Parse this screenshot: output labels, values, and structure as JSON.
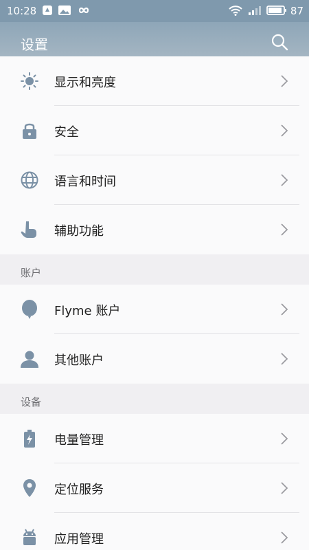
{
  "status_bar": {
    "time": "10:28",
    "battery_level": "87",
    "icons": [
      "notification-icon",
      "image-icon",
      "infinity-icon",
      "wifi-icon",
      "signal-icon",
      "battery-icon"
    ]
  },
  "header": {
    "title": "设置",
    "search_icon": "search-icon"
  },
  "sections": [
    {
      "header": "",
      "items": [
        {
          "label": "显示和亮度",
          "icon": "sun-icon"
        },
        {
          "label": "安全",
          "icon": "lock-icon"
        },
        {
          "label": "语言和时间",
          "icon": "globe-icon"
        },
        {
          "label": "辅助功能",
          "icon": "hand-icon"
        }
      ]
    },
    {
      "header": "账户",
      "items": [
        {
          "label": "Flyme 账户",
          "icon": "balloon-icon"
        },
        {
          "label": "其他账户",
          "icon": "user-icon"
        }
      ]
    },
    {
      "header": "设备",
      "items": [
        {
          "label": "电量管理",
          "icon": "battery-charging-icon"
        },
        {
          "label": "定位服务",
          "icon": "location-icon"
        },
        {
          "label": "应用管理",
          "icon": "android-icon"
        }
      ]
    }
  ],
  "colors": {
    "header": "#8ea6b8",
    "icon": "#7b91a6",
    "background": "#f4f3f6"
  }
}
